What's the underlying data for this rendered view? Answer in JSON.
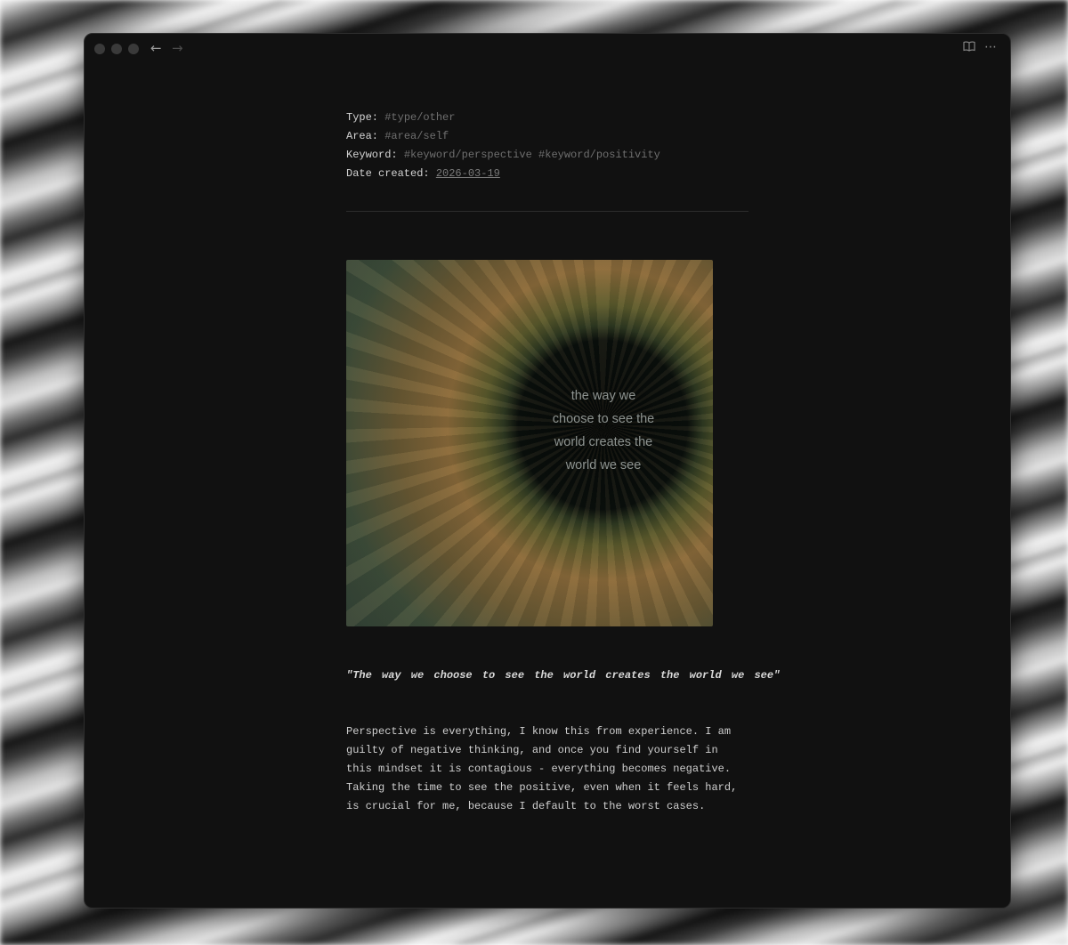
{
  "titlebar": {
    "back_glyph": "←",
    "forward_glyph": "→",
    "reading_icon": "book-icon",
    "more_glyph": "⋯"
  },
  "properties": [
    {
      "label": "Type:",
      "value": "#type/other"
    },
    {
      "label": "Area:",
      "value": "#area/self"
    },
    {
      "label": "Keyword:",
      "value": "#keyword/perspective #keyword/positivity"
    },
    {
      "label": "Date created:",
      "value": "2026-03-19"
    }
  ],
  "image": {
    "lines": [
      "the way we",
      "choose to see the",
      "world creates the",
      "world we see"
    ]
  },
  "quote": "\"The way we choose to see the world creates the world we see\"",
  "paragraph": "Perspective is everything, I know this from experience. I am guilty of negative thinking, and once you find yourself in this mindset it is contagious - everything becomes negative. Taking the time to see the positive, even when it feels hard, is crucial for me, because I default to the worst cases.",
  "colors": {
    "window_bg": "#111111",
    "text": "#d4d4d4",
    "tag": "#6f6f6f"
  }
}
